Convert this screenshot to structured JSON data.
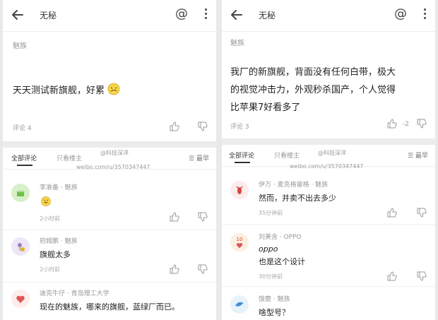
{
  "left": {
    "header": {
      "title": "无秘",
      "at": "@"
    },
    "tag": "魅族",
    "post": "天天测试新旗舰，好累",
    "comment_count": "评论 4",
    "tabs": {
      "all": "全部评论",
      "op_only": "只看楼主",
      "sort": "最早"
    },
    "watermark": "weibo.com/u/3570347447",
    "watermark_handle": "@科技深洋",
    "comments": [
      {
        "name": "李准备 · 魅族",
        "text": "",
        "time": "2小时前",
        "avatar_color": "#d8efc9"
      },
      {
        "name": "府姆鹏 · 魅族",
        "text": "旗舰太多",
        "time": "2小时前",
        "avatar_color": "#eee5f6"
      },
      {
        "name": "迪克牛仔 · 青岛理工大学",
        "text": "现在的魅族，哪来的旗舰，蓝绿厂而已。",
        "time": "",
        "avatar_color": "#fdecec"
      }
    ]
  },
  "right": {
    "header": {
      "title": "无秘",
      "at": "@"
    },
    "tag": "魅族",
    "post_lines": [
      "我厂的新旗舰，背面没有任何白带，极大",
      "的视觉冲击力，外观秒杀国产，个人觉得",
      "比苹果7好看多了"
    ],
    "comment_count": "评论 3",
    "vote_count": "-2",
    "tabs": {
      "all": "全部评论",
      "op_only": "只看楼主",
      "sort": "最早"
    },
    "watermark": "weibo.com/u/3570347447",
    "watermark_handle": "@科技深洋",
    "comments": [
      {
        "name": "伊万 · 麦克格雷格 · 魅族",
        "text": "然而，并卖不出去多少",
        "time": "35分钟前",
        "avatar_color": "#fcecec"
      },
      {
        "name": "刘美含 · OPPO",
        "subtext": "oppo",
        "text": "也是这个设计",
        "time": "30分钟前",
        "avatar_badge": "10",
        "avatar_color": "#fbf0e0"
      },
      {
        "name": "馊鹿 · 魅族",
        "text": "啥型号？",
        "time": "",
        "avatar_color": "#e8f2fb"
      }
    ]
  },
  "icons": {
    "back": "arrow-left-icon",
    "more": "vertical-dots-icon",
    "like": "thumbs-up-icon",
    "dislike": "thumbs-down-icon",
    "sort": "sort-lines-icon"
  }
}
